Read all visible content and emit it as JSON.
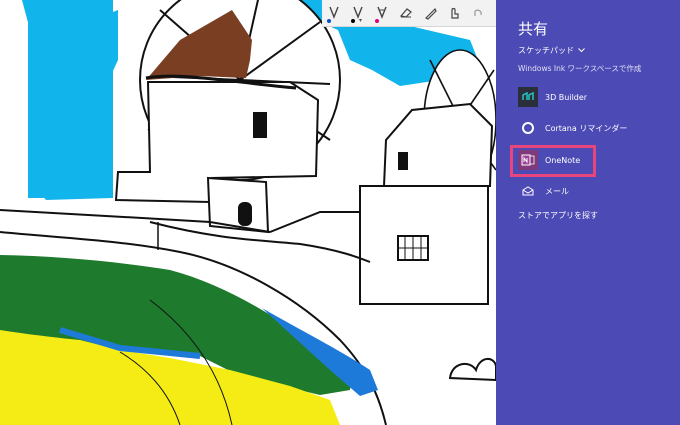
{
  "share_panel": {
    "title": "共有",
    "source_app": "スケッチパッド",
    "subtitle": "Windows Ink ワークスペースで作成",
    "apps": [
      {
        "label": "3D Builder",
        "icon": "3d-builder-icon",
        "color": "#2b2f3a"
      },
      {
        "label": "Cortana リマインダー",
        "icon": "cortana-icon",
        "color": "#4c4ab5"
      },
      {
        "label": "OneNote",
        "icon": "onenote-icon",
        "color": "#80397b"
      },
      {
        "label": "メール",
        "icon": "mail-icon",
        "color": "#4c4ab5"
      }
    ],
    "store_link": "ストアでアプリを探す",
    "background": "#4c4ab5",
    "highlight_color": "#e8457c"
  },
  "toolbar": {
    "tools": [
      {
        "name": "ballpoint-pen",
        "dot_color": "#0050d0"
      },
      {
        "name": "pencil",
        "dot_color": "#000000"
      },
      {
        "name": "highlighter",
        "dot_color": "#e0007a"
      },
      {
        "name": "eraser"
      },
      {
        "name": "ruler"
      },
      {
        "name": "touch-writing"
      },
      {
        "name": "undo"
      }
    ]
  },
  "canvas": {
    "colors": {
      "sky": "#12b4ec",
      "roof": "#7a3f22",
      "grass": "#1e7a2c",
      "sand": "#f4ec14",
      "sea": "#1e7ad8",
      "ink": "#111111"
    }
  }
}
